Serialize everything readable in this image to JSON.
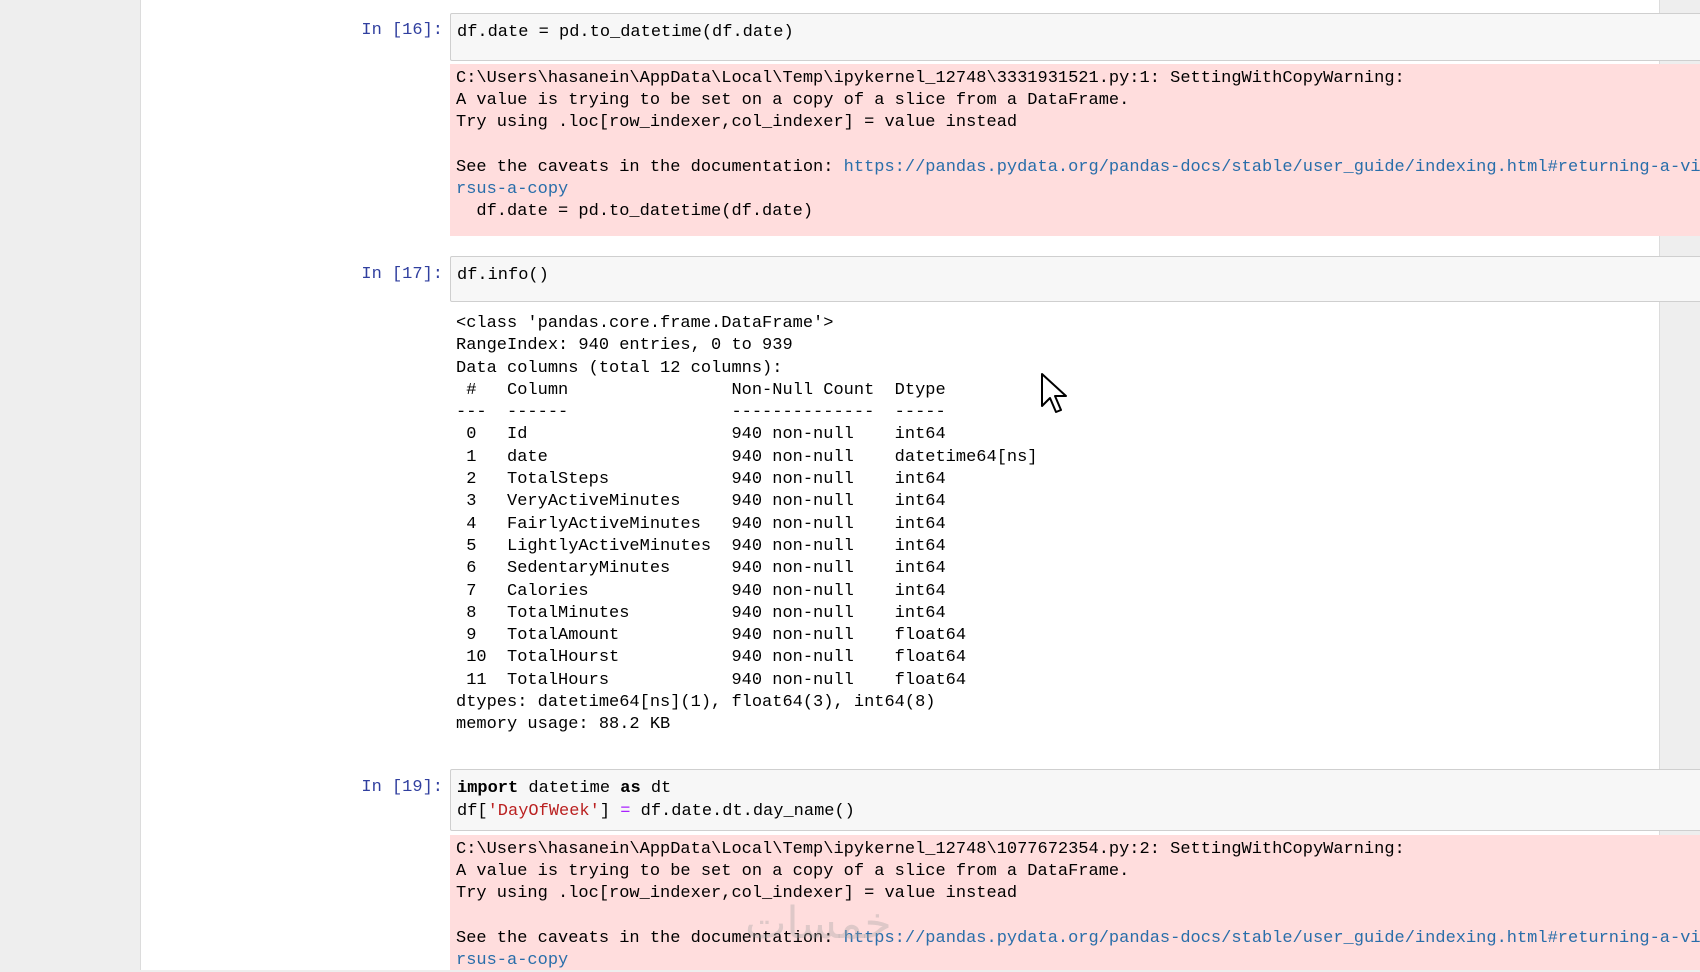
{
  "cells": [
    {
      "prompt": "In [16]:",
      "code": "df.date = pd.to_datetime(df.date)",
      "stderr": {
        "line1": "C:\\Users\\hasanein\\AppData\\Local\\Temp\\ipykernel_12748\\3331931521.py:1: SettingWithCopyWarning:",
        "line2": "A value is trying to be set on a copy of a slice from a DataFrame.",
        "line3": "Try using .loc[row_indexer,col_indexer] = value instead",
        "see_prefix": "See the caveats in the documentation: ",
        "url": "https://pandas.pydata.org/pandas-docs/stable/user_guide/indexing.html#returning-a-view-versus-a-copy",
        "tail": "  df.date = pd.to_datetime(df.date)"
      }
    },
    {
      "prompt": "In [17]:",
      "code": "df.info()",
      "stdout": {
        "header": [
          "<class 'pandas.core.frame.DataFrame'>",
          "RangeIndex: 940 entries, 0 to 939",
          "Data columns (total 12 columns):",
          " #   Column                Non-Null Count  Dtype",
          "---  ------                --------------  -----"
        ],
        "rows": [
          " 0   Id                    940 non-null    int64",
          " 1   date                  940 non-null    datetime64[ns]",
          " 2   TotalSteps            940 non-null    int64",
          " 3   VeryActiveMinutes     940 non-null    int64",
          " 4   FairlyActiveMinutes   940 non-null    int64",
          " 5   LightlyActiveMinutes  940 non-null    int64",
          " 6   SedentaryMinutes      940 non-null    int64",
          " 7   Calories              940 non-null    int64",
          " 8   TotalMinutes          940 non-null    int64",
          " 9   TotalAmount           940 non-null    float64",
          " 10  TotalHourst           940 non-null    float64",
          " 11  TotalHours            940 non-null    float64"
        ],
        "footer": [
          "dtypes: datetime64[ns](1), float64(3), int64(8)",
          "memory usage: 88.2 KB"
        ]
      }
    },
    {
      "prompt": "In [19]:",
      "code_import_kw": "import",
      "code_import_mod": " datetime ",
      "code_as_kw": "as",
      "code_import_alias": " dt",
      "code_line2_a": "df[",
      "code_line2_str": "'DayOfWeek'",
      "code_line2_b": "] ",
      "code_line2_op": "=",
      "code_line2_c": " df.date.dt.day_name()",
      "stderr": {
        "line1": "C:\\Users\\hasanein\\AppData\\Local\\Temp\\ipykernel_12748\\1077672354.py:2: SettingWithCopyWarning:",
        "line2": "A value is trying to be set on a copy of a slice from a DataFrame.",
        "line3": "Try using .loc[row_indexer,col_indexer] = value instead",
        "see_prefix": "See the caveats in the documentation: ",
        "url": "https://pandas.pydata.org/pandas-docs/stable/user_guide/indexing.html#returning-a-view-versus-a-copy"
      }
    }
  ],
  "watermark_text": "خمسات",
  "colors": {
    "prompt": "#303f9f",
    "stderr_bg": "#ffdddd",
    "link": "#296eaa"
  },
  "icons": {
    "cursor": "mouse-pointer-icon"
  }
}
